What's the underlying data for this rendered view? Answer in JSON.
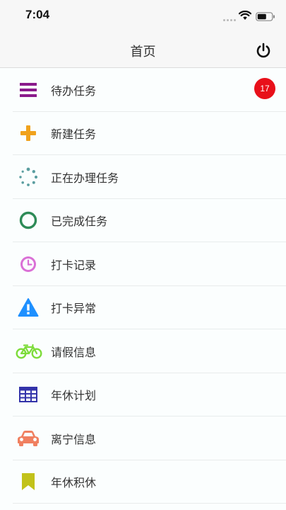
{
  "status_bar": {
    "time": "7:04"
  },
  "header": {
    "title": "首页",
    "power_icon": "power-icon"
  },
  "menu": {
    "items": [
      {
        "label": "待办任务",
        "icon": "menu-lines-icon",
        "color": "#8b1a8b",
        "badge": "17"
      },
      {
        "label": "新建任务",
        "icon": "plus-icon",
        "color": "#f0a21d"
      },
      {
        "label": "正在办理任务",
        "icon": "spinner-icon",
        "color": "#5b9ea0"
      },
      {
        "label": "已完成任务",
        "icon": "circle-icon",
        "color": "#2e8b57"
      },
      {
        "label": "打卡记录",
        "icon": "clock-icon",
        "color": "#da70d6"
      },
      {
        "label": "打卡异常",
        "icon": "warning-icon",
        "color": "#1e90ff"
      },
      {
        "label": "请假信息",
        "icon": "bicycle-icon",
        "color": "#7ddc3a"
      },
      {
        "label": "年休计划",
        "icon": "calendar-grid-icon",
        "color": "#3333aa"
      },
      {
        "label": "离宁信息",
        "icon": "car-icon",
        "color": "#f08060"
      },
      {
        "label": "年休积休",
        "icon": "bookmark-icon",
        "color": "#c2c21a"
      }
    ]
  },
  "colors": {
    "badge": "#e8101a",
    "bar_background": "#f7f7f7"
  }
}
